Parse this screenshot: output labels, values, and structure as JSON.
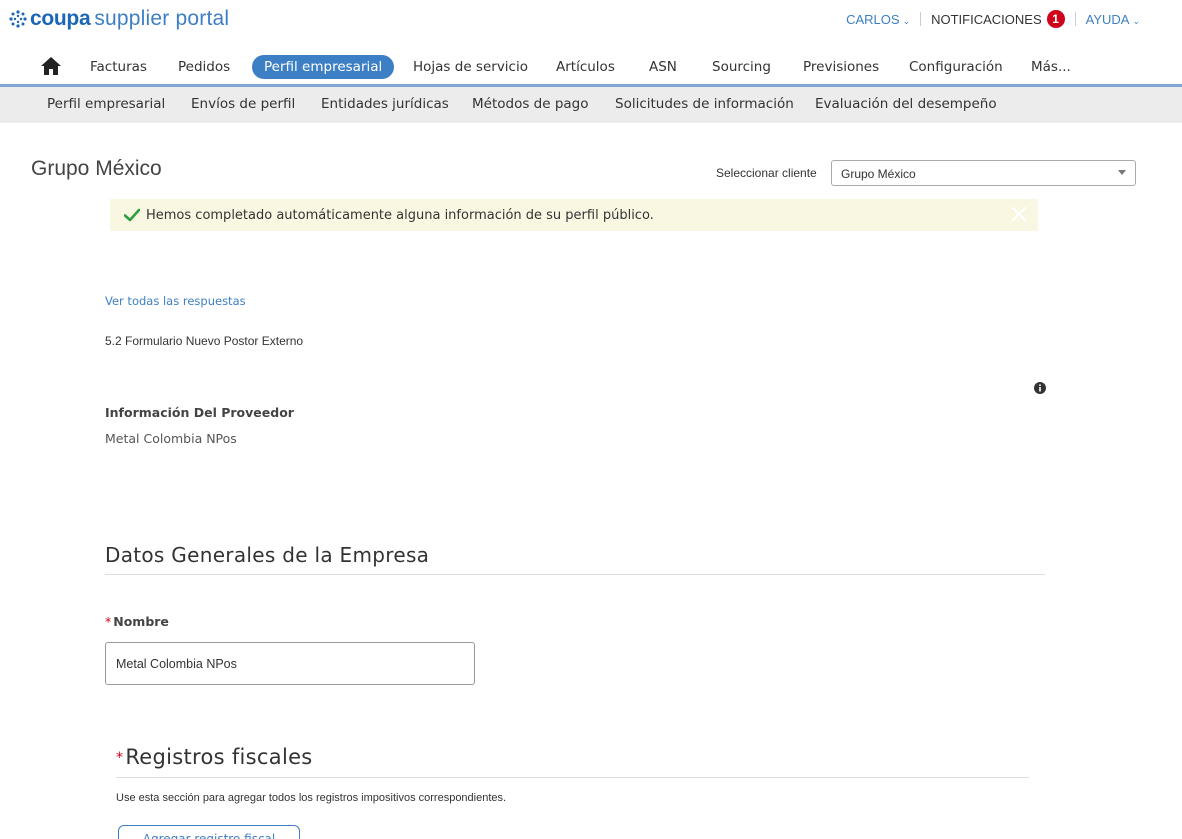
{
  "header": {
    "brand": "coupa",
    "brand_tail": "supplier portal",
    "user": "CARLOS",
    "notifications_label": "NOTIFICACIONES",
    "notifications_count": "1",
    "help": "AYUDA"
  },
  "nav": {
    "items": [
      {
        "label": "Facturas"
      },
      {
        "label": "Pedidos"
      },
      {
        "label": "Perfil empresarial"
      },
      {
        "label": "Hojas de servicio"
      },
      {
        "label": "Artículos"
      },
      {
        "label": "ASN"
      },
      {
        "label": "Sourcing"
      },
      {
        "label": "Previsiones"
      },
      {
        "label": "Configuración"
      },
      {
        "label": "Más..."
      }
    ],
    "active_index": 2
  },
  "subnav": {
    "items": [
      {
        "label": "Perfil empresarial"
      },
      {
        "label": "Envíos de perfil"
      },
      {
        "label": "Entidades jurídicas"
      },
      {
        "label": "Métodos de pago"
      },
      {
        "label": "Solicitudes de información"
      },
      {
        "label": "Evaluación del desempeño"
      }
    ]
  },
  "page": {
    "title": "Grupo México",
    "client_label": "Seleccionar cliente",
    "client_value": "Grupo México",
    "notice": "Hemos completado automáticamente alguna información de su perfil público.",
    "view_all": "Ver todas las respuestas",
    "form_name": "5.2 Formulario Nuevo Postor Externo",
    "supplier_label": "Información Del Proveedor",
    "supplier_value": "Metal Colombia NPos"
  },
  "general": {
    "title": "Datos Generales de la Empresa",
    "required_mark": "*",
    "name_label": "Nombre",
    "name_value": "Metal Colombia NPos"
  },
  "fiscal": {
    "required_mark": "*",
    "title": "Registros fiscales",
    "help": "Use esta sección para agregar todos los registros impositivos correspondientes.",
    "add_button": "Agregar registro fiscal"
  },
  "colors": {
    "accent": "#3d7fc4",
    "badge": "#d0021b",
    "notice_bg": "#f9f7e2",
    "check": "#2e9e3e"
  },
  "icons": [
    "coupa-logo-icon",
    "chevron-down-icon",
    "home-icon",
    "check-icon",
    "close-icon",
    "info-icon",
    "dropdown-arrow-icon"
  ]
}
